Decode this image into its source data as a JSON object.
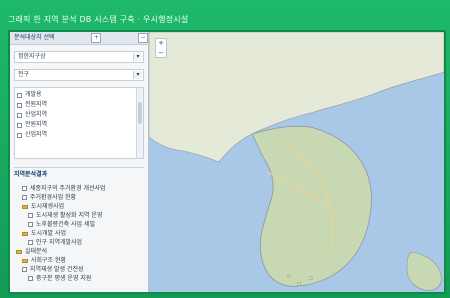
{
  "title_bar": {
    "text": "그래픽 한 지역 분석 DB 시스템 구축 · 우시행정시설"
  },
  "sidebar": {
    "header_label": "분석대상지 선택",
    "header_buttons": [
      "+",
      "−"
    ],
    "select_1": "정한지구상",
    "select_2": "전구",
    "list_items": [
      {
        "label": "개발용"
      },
      {
        "label": "전원지역"
      },
      {
        "label": "산업지역"
      },
      {
        "label": "전원지역"
      },
      {
        "label": "산업지역"
      }
    ],
    "section_title": "지역분석결과",
    "tree": [
      {
        "label": "세종지구의 주거환경 개선사업",
        "level": 1,
        "type": "checkbox"
      },
      {
        "label": "주거환경사업 현황",
        "level": 1,
        "type": "checkbox"
      },
      {
        "label": "도시재생사업",
        "level": 1,
        "type": "folder"
      },
      {
        "label": "도시재생 활성화 지역 운영",
        "level": 2,
        "type": "checkbox"
      },
      {
        "label": "노후불량건축 사업 세밀",
        "level": 2,
        "type": "checkbox"
      },
      {
        "label": "도시개발 사업",
        "level": 1,
        "type": "folder"
      },
      {
        "label": "인구 지역개발사업",
        "level": 2,
        "type": "checkbox"
      },
      {
        "label": "실태분석",
        "level": 0,
        "type": "folder"
      },
      {
        "label": "사회구조 현황",
        "level": 1,
        "type": "folder"
      },
      {
        "label": "지역재생 발생 건전성",
        "level": 1,
        "type": "checkbox"
      },
      {
        "label": "중구분 평생 운영 지원",
        "level": 2,
        "type": "checkbox"
      }
    ]
  },
  "map": {
    "zoom_in": "+",
    "zoom_out": "−",
    "colors": {
      "sea": "#a9c8e8",
      "land": "#e4ead7",
      "land_green": "#c8d8b2",
      "road": "#f2d38e",
      "boundary": "#8b96a3"
    }
  }
}
